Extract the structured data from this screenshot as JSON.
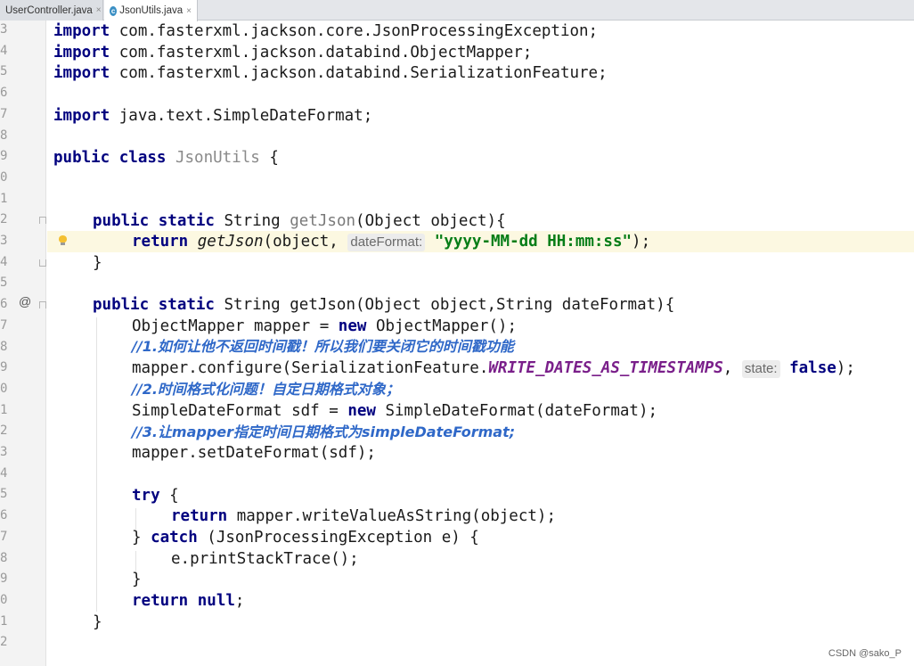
{
  "tabs": [
    {
      "label": "UserController.java",
      "close": "×"
    },
    {
      "label": "JsonUtils.java",
      "close": "×",
      "icon_letter": "c"
    }
  ],
  "line_numbers": [
    "3",
    "4",
    "5",
    "6",
    "7",
    "8",
    "9",
    "0",
    "1",
    "2",
    "3",
    "4",
    "5",
    "6",
    "7",
    "8",
    "9",
    "0",
    "1",
    "2",
    "3",
    "4",
    "5",
    "6",
    "7",
    "8",
    "9",
    "0",
    "1",
    "2"
  ],
  "override_marker": "@",
  "code": {
    "l3": {
      "kw": "import",
      "rest": " com.fasterxml.jackson.core.JsonProcessingException;"
    },
    "l4": {
      "kw": "import",
      "rest": " com.fasterxml.jackson.databind.ObjectMapper;"
    },
    "l5": {
      "kw": "import",
      "rest": " com.fasterxml.jackson.databind.SerializationFeature;"
    },
    "l7": {
      "kw": "import",
      "rest": " java.text.SimpleDateFormat;"
    },
    "l9": {
      "kw": "public class",
      "cls": "JsonUtils",
      "rest": " {"
    },
    "l12": {
      "kw": "public static",
      "type": " String ",
      "name": "getJson",
      "rest": "(Object object){"
    },
    "l13": {
      "kw": "return",
      "call": "getJson",
      "pre": "(object, ",
      "hint": "dateFormat:",
      "str": "\"yyyy-MM-dd HH:mm:ss\"",
      "rest": ");"
    },
    "l14": {
      "rest": "}"
    },
    "l16": {
      "kw": "public static",
      "rest": " String getJson(Object object,String dateFormat){"
    },
    "l17": {
      "pre": "ObjectMapper mapper = ",
      "kw": "new",
      "rest": " ObjectMapper();"
    },
    "l18": {
      "comment": "//1.如何让他不返回时间戳！所以我们要关闭它的时间戳功能"
    },
    "l19": {
      "pre": "mapper.configure(SerializationFeature.",
      "const": "WRITE_DATES_AS_TIMESTAMPS",
      "sep": ", ",
      "hint": "state:",
      "kw": "false",
      "rest": ");"
    },
    "l20": {
      "comment": "//2.时间格式化问题！自定日期格式对象；"
    },
    "l21": {
      "pre": "SimpleDateFormat sdf = ",
      "kw": "new",
      "rest": " SimpleDateFormat(dateFormat);"
    },
    "l22": {
      "comment": "//3.让mapper指定时间日期格式为simpleDateFormat;"
    },
    "l23": {
      "rest": "mapper.setDateFormat(sdf);"
    },
    "l25": {
      "kw": "try",
      "rest": " {"
    },
    "l26": {
      "kw": "return",
      "rest": " mapper.writeValueAsString(object);"
    },
    "l27": {
      "pre": "} ",
      "kw": "catch",
      "rest": " (JsonProcessingException e) {"
    },
    "l28": {
      "rest": "e.printStackTrace();"
    },
    "l29": {
      "rest": "}"
    },
    "l30": {
      "kw": "return",
      "rest": " ",
      "kw2": "null",
      "end": ";"
    },
    "l31": {
      "rest": "}"
    }
  },
  "watermark": "CSDN @sako_P",
  "colors": {
    "keyword": "#00007f",
    "string": "#067d17",
    "comment": "#2f68c8",
    "constant": "#7a1f8a",
    "caret_line": "#fcf8e1"
  }
}
